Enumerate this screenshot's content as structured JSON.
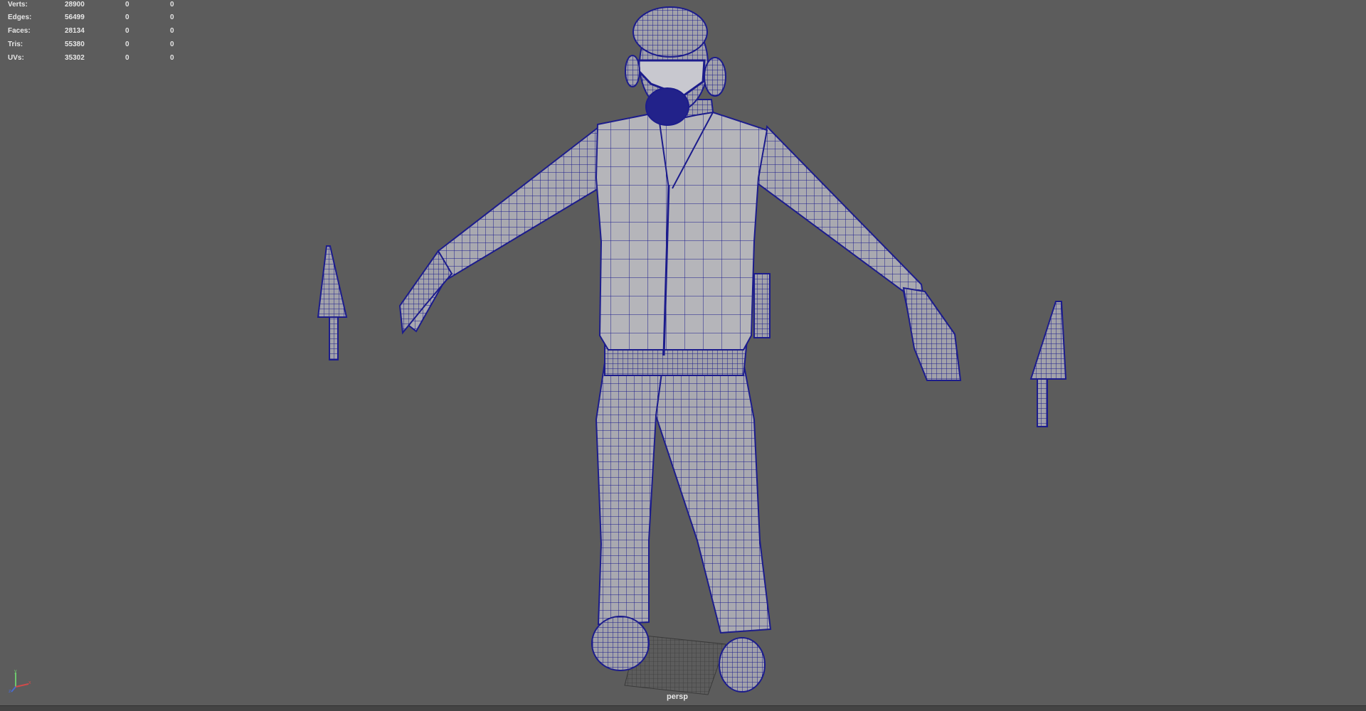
{
  "hud": {
    "rows": [
      {
        "label": "Verts:",
        "v1": "28900",
        "v2": "0",
        "v3": "0"
      },
      {
        "label": "Edges:",
        "v1": "56499",
        "v2": "0",
        "v3": "0"
      },
      {
        "label": "Faces:",
        "v1": "28134",
        "v2": "0",
        "v3": "0"
      },
      {
        "label": "Tris:",
        "v1": "55380",
        "v2": "0",
        "v3": "0"
      },
      {
        "label": "UVs:",
        "v1": "35302",
        "v2": "0",
        "v3": "0"
      }
    ]
  },
  "viewport": {
    "camera_label": "persp",
    "background_color": "#5c5c5c",
    "wireframe_color": "#1c1c8c",
    "mesh_fill_color": "#a9a9b0"
  },
  "axis_gizmo": {
    "x_label": "x",
    "y_label": "y",
    "z_label": "z"
  }
}
